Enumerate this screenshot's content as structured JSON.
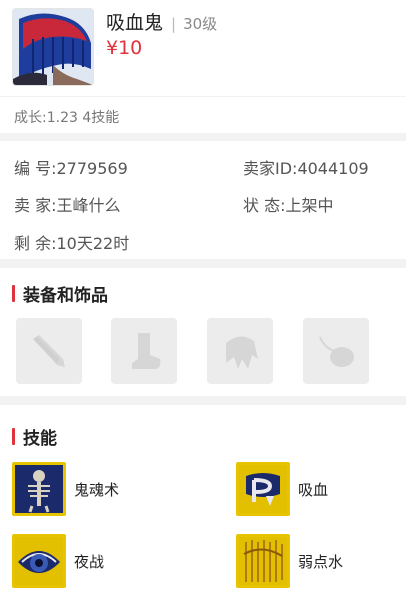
{
  "pet": {
    "name": "吸血鬼",
    "separator": "|",
    "level": "30级",
    "price": "¥10"
  },
  "growth": "成长:1.23 4技能",
  "info": {
    "id_label": "编 号:",
    "id_value": "2779569",
    "seller_id_label": "卖家ID:",
    "seller_id_value": "4044109",
    "seller_label": "卖 家:",
    "seller_value": "王峰什么",
    "status_label": "状 态:",
    "status_value": "上架中",
    "remaining_label": "剩 余:",
    "remaining_value": "10天22时"
  },
  "equipment": {
    "title": "装备和饰品",
    "slots": [
      {
        "icon": "weapon-icon"
      },
      {
        "icon": "boots-icon"
      },
      {
        "icon": "armor-icon"
      },
      {
        "icon": "accessory-icon"
      }
    ]
  },
  "skills": {
    "title": "技能",
    "items": [
      {
        "name": "鬼魂术",
        "icon": "skeleton-icon"
      },
      {
        "name": "吸血",
        "icon": "fang-icon"
      },
      {
        "name": "夜战",
        "icon": "eye-icon"
      },
      {
        "name": "弱点水",
        "icon": "water-icon"
      }
    ]
  },
  "colors": {
    "accent": "#e0323c",
    "skill_icon_bg": "#e6c400"
  }
}
